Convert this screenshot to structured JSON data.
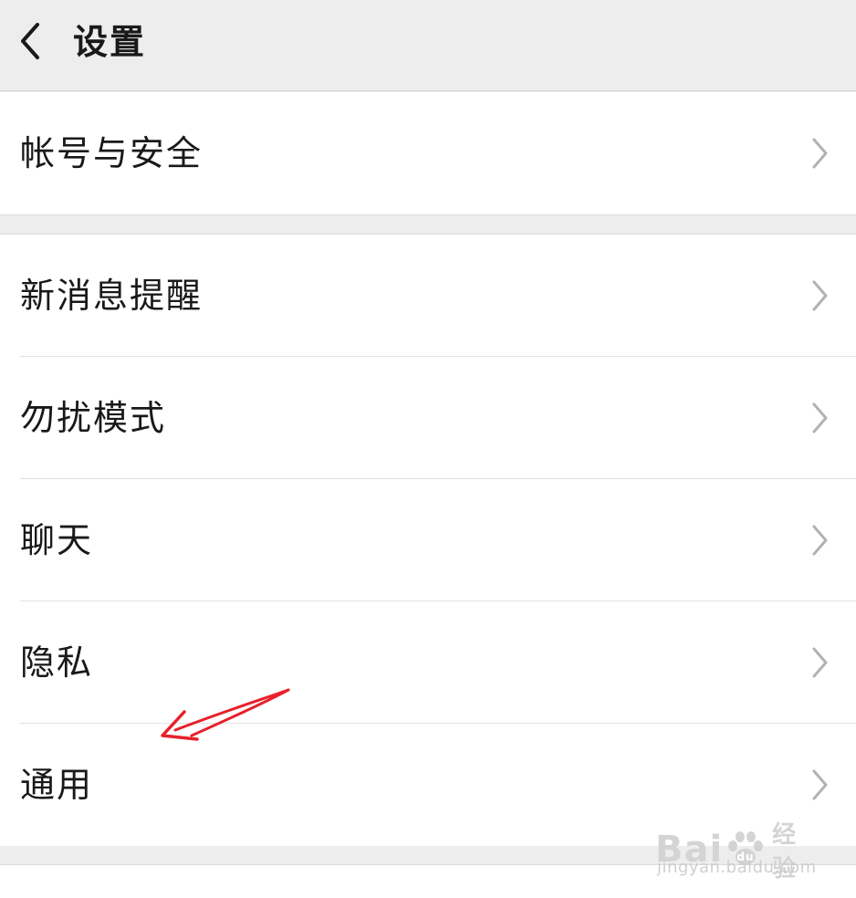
{
  "header": {
    "title": "设置",
    "back_icon": "chevron-left-icon"
  },
  "groups": [
    {
      "items": [
        {
          "label": "帐号与安全",
          "icon": "chevron-right-icon"
        }
      ]
    },
    {
      "items": [
        {
          "label": "新消息提醒",
          "icon": "chevron-right-icon"
        },
        {
          "label": "勿扰模式",
          "icon": "chevron-right-icon"
        },
        {
          "label": "聊天",
          "icon": "chevron-right-icon"
        },
        {
          "label": "隐私",
          "icon": "chevron-right-icon"
        },
        {
          "label": "通用",
          "icon": "chevron-right-icon"
        }
      ]
    }
  ],
  "annotation": {
    "arrow_color": "#e8202a",
    "points_to": "通用"
  },
  "watermark": {
    "logo_left": "Bai",
    "logo_right": "经验",
    "url": "jingyan.baidu.com"
  },
  "colors": {
    "background": "#ededed",
    "card": "#ffffff",
    "text": "#191919",
    "chevron": "#b2b2b2"
  }
}
